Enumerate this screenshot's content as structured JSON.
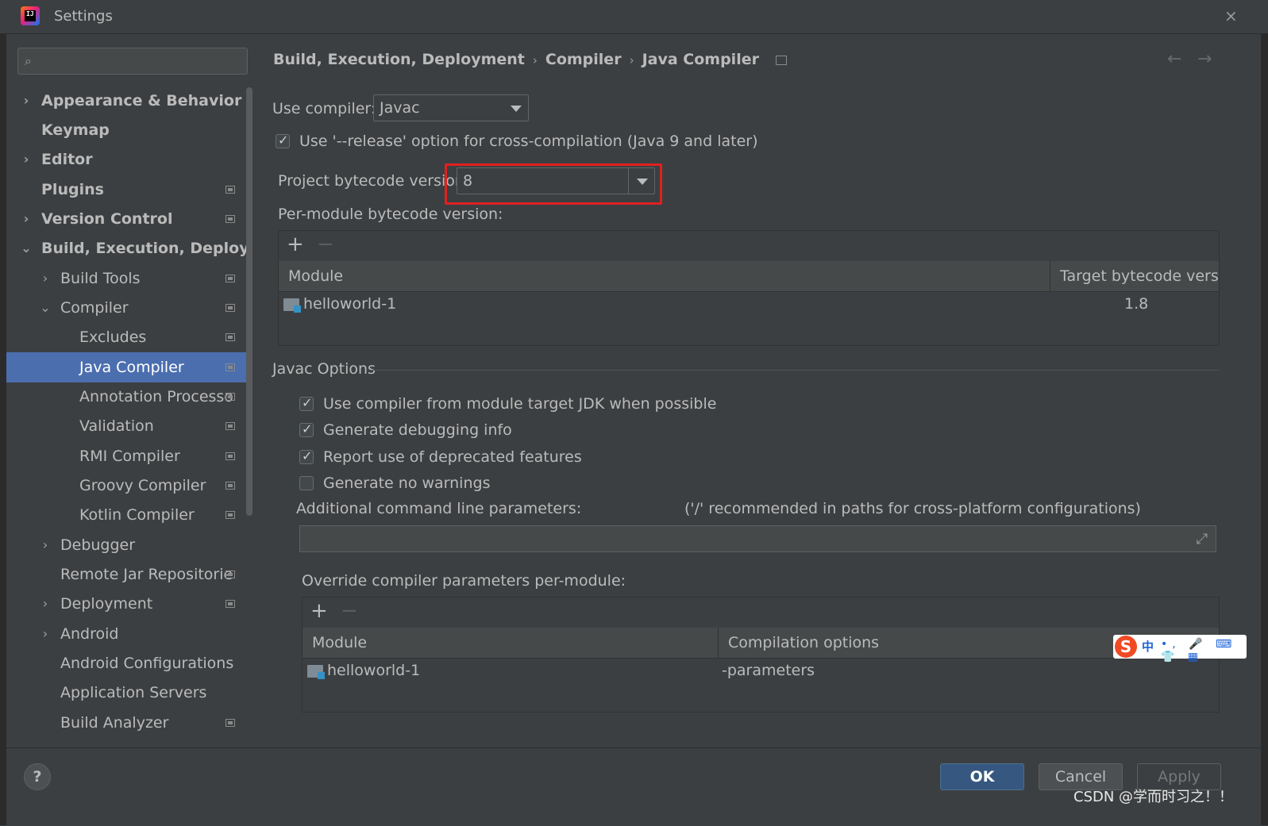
{
  "window": {
    "title": "Settings",
    "close": "×"
  },
  "search": {
    "placeholder": ""
  },
  "sidebar": {
    "items": [
      {
        "label": "Appearance & Behavior",
        "chev": "›"
      },
      {
        "label": "Keymap",
        "chev": ""
      },
      {
        "label": "Editor",
        "chev": "›"
      },
      {
        "label": "Plugins",
        "chev": ""
      },
      {
        "label": "Version Control",
        "chev": "›"
      },
      {
        "label": "Build, Execution, Deployme",
        "chev": "⌄"
      },
      {
        "label": "Build Tools",
        "chev": "›"
      },
      {
        "label": "Compiler",
        "chev": "⌄"
      },
      {
        "label": "Excludes",
        "chev": ""
      },
      {
        "label": "Java Compiler",
        "chev": ""
      },
      {
        "label": "Annotation Processo",
        "chev": ""
      },
      {
        "label": "Validation",
        "chev": ""
      },
      {
        "label": "RMI Compiler",
        "chev": ""
      },
      {
        "label": "Groovy Compiler",
        "chev": ""
      },
      {
        "label": "Kotlin Compiler",
        "chev": ""
      },
      {
        "label": "Debugger",
        "chev": "›"
      },
      {
        "label": "Remote Jar Repositorie",
        "chev": ""
      },
      {
        "label": "Deployment",
        "chev": "›"
      },
      {
        "label": "Android",
        "chev": "›"
      },
      {
        "label": "Android Configurations",
        "chev": ""
      },
      {
        "label": "Application Servers",
        "chev": ""
      },
      {
        "label": "Build Analyzer",
        "chev": ""
      }
    ]
  },
  "breadcrumb": {
    "parts": [
      "Build, Execution, Deployment",
      "Compiler",
      "Java Compiler"
    ],
    "sep": "›",
    "back": "←",
    "forward": "→"
  },
  "compiler": {
    "use_compiler_label": "Use compiler:",
    "use_compiler_value": "Javac",
    "release_option_label": "Use '--release' option for cross-compilation (Java 9 and later)",
    "bytecode_label": "Project bytecode version",
    "bytecode_value": "8",
    "per_module_label": "Per-module bytecode version:",
    "per_module_table": {
      "columns": [
        "Module",
        "Target bytecode versi..."
      ],
      "rows": [
        {
          "module": "helloworld-1",
          "target": "1.8"
        }
      ]
    }
  },
  "javac": {
    "section_title": "Javac Options",
    "options": [
      {
        "label": "Use compiler from module target JDK when possible",
        "checked": true
      },
      {
        "label": "Generate debugging info",
        "checked": true
      },
      {
        "label": "Report use of deprecated features",
        "checked": true
      },
      {
        "label": "Generate no warnings",
        "checked": false
      }
    ],
    "additional_params_label": "Additional command line parameters:",
    "additional_params_hint": "('/' recommended in paths for cross-platform configurations)",
    "additional_params_value": "",
    "override_label": "Override compiler parameters per-module:",
    "override_table": {
      "columns": [
        "Module",
        "Compilation options"
      ],
      "rows": [
        {
          "module": "helloworld-1",
          "options": "-parameters"
        }
      ]
    }
  },
  "table_toolbar": {
    "add": "+",
    "remove": "−"
  },
  "footer": {
    "help": "?",
    "ok": "OK",
    "cancel": "Cancel",
    "apply": "Apply"
  },
  "overlay": {
    "watermark": "CSDN @学而时习之！！",
    "ime_logo": "S",
    "ime_lang": "中",
    "ime_tools": "•, 🎤 ⌨ 👕 ▦"
  },
  "colors": {
    "background": "#3c3f41",
    "selection": "#4b6eaf",
    "highlight_border": "#e02020",
    "ok_button": "#365880"
  }
}
